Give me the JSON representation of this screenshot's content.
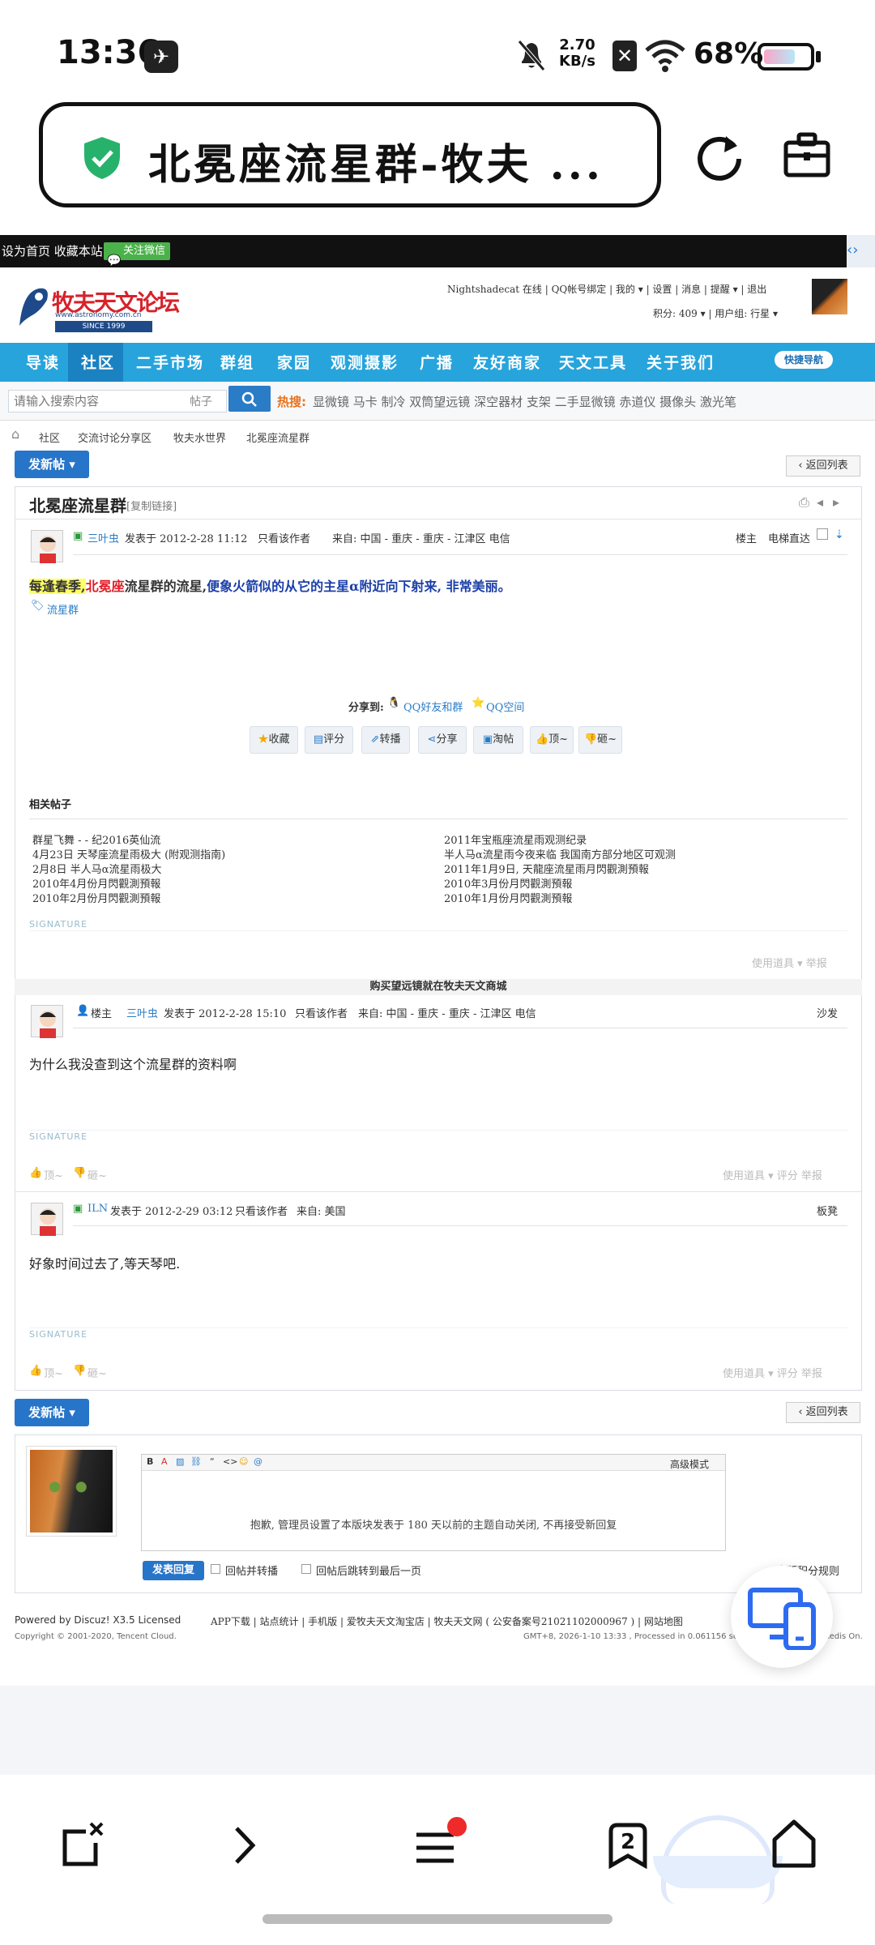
{
  "status_bar": {
    "time": "13:36",
    "net_speed": "2.70",
    "net_unit": "KB/s",
    "battery": "68%"
  },
  "browser": {
    "title": "北冕座流星群-牧夫 ...",
    "tab_count": "2"
  },
  "topbar": {
    "links": "设为首页 收藏本站",
    "wechat": "关注微信"
  },
  "header": {
    "logo_cn": "牧夫天文论坛",
    "logo_url": "www.astronomy.com.cn",
    "logo_since": "SINCE 1999",
    "user_line": "Nightshadecat 在线 | QQ帐号绑定 | 我的 ▾ | 设置 | 消息 | 提醒 ▾ | 退出",
    "points_line": "积分: 409 ▾  |  用户组: 行星 ▾"
  },
  "nav": {
    "items": [
      "导读",
      "社区",
      "二手市场",
      "群组",
      "家园",
      "观测摄影",
      "广播",
      "友好商家",
      "天文工具",
      "关于我们"
    ],
    "quick": "快捷导航"
  },
  "search": {
    "placeholder": "请输入搜索内容",
    "type": "帖子",
    "hot_label": "热搜:",
    "hot_terms": "显微镜 马卡 制冷 双筒望远镜 深空器材 支架 二手显微镜 赤道仪 摄像头 激光笔"
  },
  "breadcrumb": [
    "社区",
    "交流讨论分享区",
    "牧夫水世界",
    "北冕座流星群"
  ],
  "buttons": {
    "new_post": "发新帖 ▾",
    "back_list": "‹ 返回列表"
  },
  "thread": {
    "title": "北冕座流星群",
    "copy_link": "[复制链接]",
    "post1": {
      "author": "三叶虫",
      "date": "发表于 2012-2-28 11:12",
      "only_author": "只看该作者",
      "from": "来自: 中国 - 重庆 - 重庆 - 江津区 电信",
      "floor": "楼主",
      "jump": "电梯直达",
      "text_a": "每逢春季,",
      "text_b": "北冕座",
      "text_c": "流星群的流星,",
      "text_d": "便象火箭似的从它的主星α附近向下射来, 非常美丽。",
      "tag": "流星群",
      "share_label": "分享到:",
      "share_qq": "QQ好友和群",
      "share_zone": "QQ空间",
      "actions": [
        "收藏",
        "评分",
        "转播",
        "分享",
        "淘帖",
        "顶~",
        "砸~"
      ]
    },
    "related_title": "相关帖子",
    "related_left": [
      "群星飞舞 - - 纪2016英仙流",
      "4月23日 天琴座流星雨极大 (附观测指南)",
      "2月8日 半人马α流星雨极大",
      "2010年4月份月閃觀測預報",
      "2010年2月份月閃觀測預報"
    ],
    "related_right": [
      "2011年宝瓶座流星雨观测纪录",
      "半人马α流星雨今夜来临 我国南方部分地区可观测",
      "2011年1月9日, 天龍座流星雨月閃觀測預報",
      "2010年3月份月閃觀測預報",
      "2010年1月份月閃觀測預報"
    ],
    "signature": "SIGNATURE",
    "tools": "使用道具 ▾  举报",
    "ad": "购买望远镜就在牧夫天文商城",
    "post2": {
      "role": "楼主",
      "author": "三叶虫",
      "date": "发表于 2012-2-28 15:10",
      "only_author": "只看该作者",
      "from": "来自: 中国 - 重庆 - 重庆 - 江津区 电信",
      "floor": "沙发",
      "text": "为什么我没查到这个流星群的资料啊"
    },
    "post3": {
      "author": "ILN",
      "date": "发表于 2012-2-29 03:12",
      "only_author": "只看该作者",
      "from": "来自: 美国",
      "floor": "板凳",
      "text": "好象时间过去了,等天琴吧."
    },
    "vote_up": "顶~",
    "vote_down": "砸~",
    "tools2": "使用道具 ▾  评分  举报"
  },
  "reply": {
    "advanced": "高级模式",
    "closed_notice": "抱歉, 管理员设置了本版块发表于 180 天以前的主题自动关闭, 不再接受新回复",
    "submit": "发表回复",
    "opt1": "回帖并转播",
    "opt2": "回帖后跳转到最后一页",
    "rules": "本版积分规则"
  },
  "footer": {
    "powered": "Powered by Discuz! X3.5 Licensed",
    "copyright": "Copyright © 2001-2020, Tencent Cloud.",
    "links": "APP下载 | 站点统计 | 手机版 | 爱牧夫天文淘宝店 | 牧夫天文网 ( 公安备案号21021102000967 ) | 网站地图",
    "gmt": "GMT+8, 2026-1-10 13:33 , Processed in 0.061156 second(s), 24 queries , Redis On."
  }
}
